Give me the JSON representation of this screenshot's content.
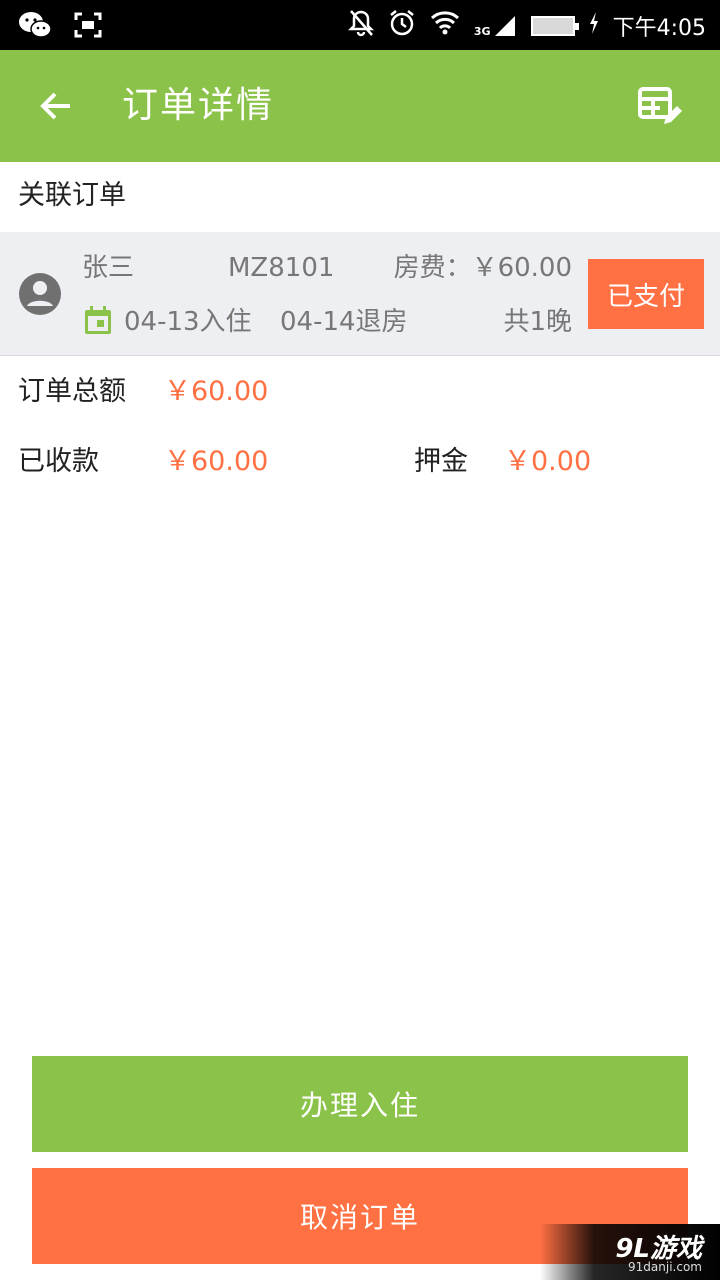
{
  "status_bar": {
    "time": "下午4:05",
    "network": "3G",
    "icons": [
      "wechat-icon",
      "screenshot-icon",
      "mute-notification-icon",
      "alarm-icon",
      "wifi-icon",
      "signal-icon",
      "battery-icon",
      "charging-icon"
    ]
  },
  "appbar": {
    "title": "订单详情",
    "back_icon": "arrow-back-icon",
    "action_icon": "table-edit-icon"
  },
  "related_section": {
    "title": "关联订单"
  },
  "order": {
    "guest_name": "张三",
    "room_no": "MZ8101",
    "room_fee": "房费：￥60.00",
    "checkin": "04-13入住",
    "checkout": "04-14退房",
    "nights": "共1晚",
    "status": "已支付"
  },
  "summary": {
    "total_label": "订单总额",
    "total_value": "￥60.00",
    "received_label": "已收款",
    "received_value": "￥60.00",
    "deposit_label": "押金",
    "deposit_value": "￥0.00"
  },
  "actions": {
    "checkin_label": "办理入住",
    "cancel_label": "取消订单"
  },
  "watermark": {
    "logo": "9L游戏",
    "url": "91danji.com"
  },
  "colors": {
    "primary": "#8bc34a",
    "accent": "#ff7043",
    "card_bg": "#eeeff3"
  }
}
